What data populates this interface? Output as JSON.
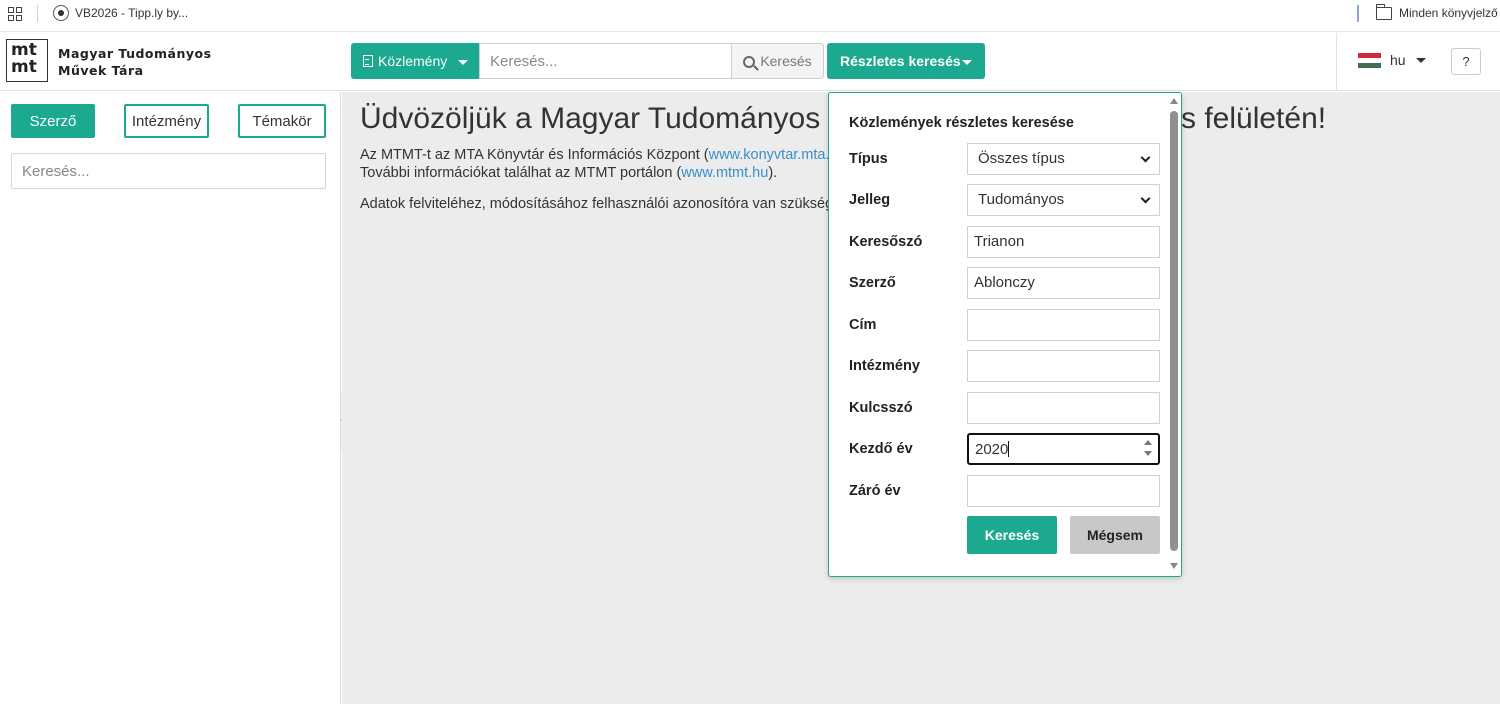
{
  "bookmarks": {
    "item": "VB2026 - Tipp.ly by...",
    "all_bookmarks": "Minden könyvjelző"
  },
  "header": {
    "logo_text_line1": "mt",
    "logo_text_line2": "mt",
    "title_line1": "Magyar Tudományos",
    "title_line2": "Művek Tára",
    "type_dropdown": "Közlemény",
    "search_placeholder": "Keresés...",
    "search_button": "Keresés",
    "advanced_button": "Részletes keresés",
    "language": "hu",
    "help": "?",
    "accent_color": "#1ba98f"
  },
  "sidebar": {
    "tabs": [
      {
        "label": "Szerző",
        "active": true
      },
      {
        "label": "Intézmény",
        "active": false
      },
      {
        "label": "Témakör",
        "active": false
      }
    ],
    "search_placeholder": "Keresés..."
  },
  "main": {
    "welcome_start": "Üdvözöljük a Magyar Tudományos M",
    "welcome_end": "s felületén!",
    "line1_text": "Az MTMT-t az MTA Könyvtár és Információs Központ (",
    "line1_link": "www.konyvtar.mta.",
    "line2_text": "További információkat találhat az MTMT portálon (",
    "line2_link": "www.mtmt.hu",
    "line2_end": ").",
    "line3_text": "Adatok felviteléhez, módosításához felhasználói azonosítóra van szüksége"
  },
  "popup": {
    "title": "Közlemények részletes keresése",
    "fields": [
      {
        "label": "Típus",
        "type": "select",
        "value": "Összes típus"
      },
      {
        "label": "Jelleg",
        "type": "select",
        "value": "Tudományos"
      },
      {
        "label": "Keresőszó",
        "type": "input",
        "value": "Trianon"
      },
      {
        "label": "Szerző",
        "type": "input",
        "value": "Ablonczy"
      },
      {
        "label": "Cím",
        "type": "input",
        "value": ""
      },
      {
        "label": "Intézmény",
        "type": "input",
        "value": ""
      },
      {
        "label": "Kulcsszó",
        "type": "input",
        "value": ""
      },
      {
        "label": "Kezdő év",
        "type": "number",
        "value": "2020"
      },
      {
        "label": "Záró év",
        "type": "input",
        "value": ""
      }
    ],
    "search_button": "Keresés",
    "cancel_button": "Mégsem"
  }
}
